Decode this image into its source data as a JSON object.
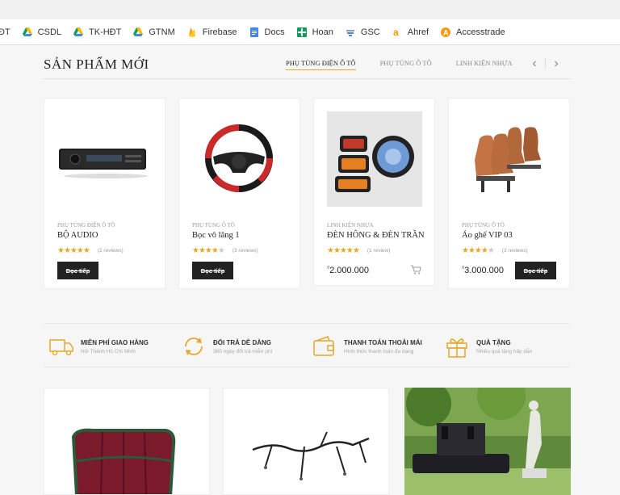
{
  "bookmarks": [
    {
      "label": "ĐT",
      "icon": "none"
    },
    {
      "label": "CSDL",
      "icon": "drive-icon"
    },
    {
      "label": "TK-HĐT",
      "icon": "drive-icon"
    },
    {
      "label": "GTNM",
      "icon": "drive-icon"
    },
    {
      "label": "Firebase",
      "icon": "firebase-icon"
    },
    {
      "label": "Docs",
      "icon": "docs-icon"
    },
    {
      "label": "Hoan",
      "icon": "sheets-icon"
    },
    {
      "label": "GSC",
      "icon": "gsc-icon"
    },
    {
      "label": "Ahref",
      "icon": "amazon-icon"
    },
    {
      "label": "Accesstrade",
      "icon": "accesstrade-icon"
    }
  ],
  "section": {
    "title": "SẢN PHẨM MỚI",
    "tabs": [
      "PHỤ TÙNG ĐIỆN Ô TÔ",
      "PHỤ TÙNG Ô TÔ",
      "LINH KIỆN NHỰA"
    ],
    "active_tab": 0,
    "prev": "‹",
    "next": "›"
  },
  "products": [
    {
      "category": "PHỤ TÙNG ĐIỆN Ô TÔ",
      "name": "BỘ AUDIO",
      "stars": 5,
      "reviews": "(2 reviews)",
      "button": "Đọc tiếp",
      "image": "car-audio"
    },
    {
      "category": "PHỤ TÙNG Ô TÔ",
      "name": "Bọc vô lăng 1",
      "stars": 4,
      "reviews": "(3 reviews)",
      "button": "Đọc tiếp",
      "image": "steering-cover"
    },
    {
      "category": "LINH KIỆN NHỰA",
      "name": "ĐÈN HÔNG & ĐÈN TRẦN",
      "stars": 5,
      "reviews": "(1 review)",
      "price": "2.000.000",
      "currency": "₫",
      "image": "car-lights"
    },
    {
      "category": "PHỤ TÙNG Ô TÔ",
      "name": "Áo ghế VIP 03",
      "stars": 4,
      "reviews": "(3 reviews)",
      "price": "3.000.000",
      "currency": "₫",
      "button": "Đọc tiếp",
      "image": "car-seats"
    }
  ],
  "features": [
    {
      "title": "MIỄN PHÍ GIAO HÀNG",
      "subtitle": "Nội Thành Hồ Chí Minh",
      "icon": "truck-icon"
    },
    {
      "title": "ĐỔI TRẢ DỄ DÀNG",
      "subtitle": "365 ngày đổi trả miễn phí",
      "icon": "refresh-icon"
    },
    {
      "title": "THANH TOÁN THOẢI MÁI",
      "subtitle": "Hình thức thanh toán đa dạng",
      "icon": "wallet-icon"
    },
    {
      "title": "QUÀ TẶNG",
      "subtitle": "Nhiều quà tặng hấp dẫn",
      "icon": "gift-icon"
    }
  ],
  "colors": {
    "accent": "#e3a92b",
    "dark": "#222222"
  }
}
